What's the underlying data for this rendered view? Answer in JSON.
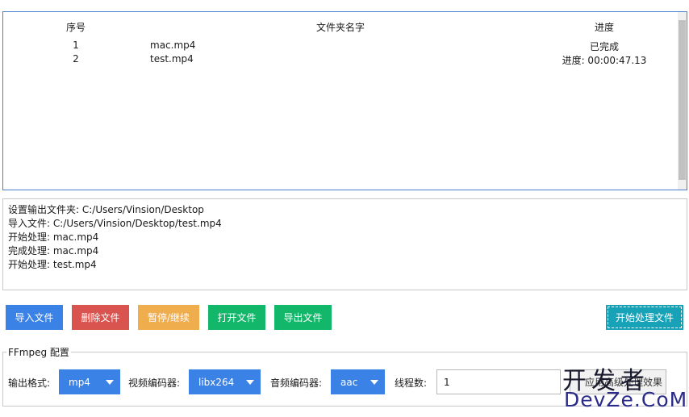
{
  "file_table": {
    "headers": {
      "no": "序号",
      "name": "文件夹名字",
      "progress": "进度"
    },
    "rows": [
      {
        "no": "1",
        "name": "mac.mp4",
        "progress": "已完成"
      },
      {
        "no": "2",
        "name": "test.mp4",
        "progress": "进度: 00:00:47.13"
      }
    ]
  },
  "log": {
    "lines": [
      "设置输出文件夹: C:/Users/Vinsion/Desktop",
      "导入文件: C:/Users/Vinsion/Desktop/test.mp4",
      "开始处理: mac.mp4",
      "完成处理: mac.mp4",
      "开始处理: test.mp4"
    ]
  },
  "toolbar": {
    "import_label": "导入文件",
    "delete_label": "删除文件",
    "pause_label": "暂停/继续",
    "open_label": "打开文件",
    "export_label": "导出文件",
    "start_label": "开始处理文件"
  },
  "config": {
    "legend": "FFmpeg 配置",
    "format_label": "输出格式:",
    "format_value": "mp4",
    "video_label": "视频编码器:",
    "video_value": "libx264",
    "audio_label": "音频编码器:",
    "audio_value": "aac",
    "threads_label": "线程数:",
    "threads_value": "1",
    "apply_label": "应用高级处理效果"
  },
  "watermark": {
    "top": "开发者",
    "bottom": "DevZe.CoM"
  },
  "colors": {
    "primary": "#3b82e6",
    "danger": "#d9534f",
    "warning": "#f0ad4e",
    "success": "#12b76a",
    "info": "#17a2b8",
    "table_border": "#4a7fd0"
  }
}
